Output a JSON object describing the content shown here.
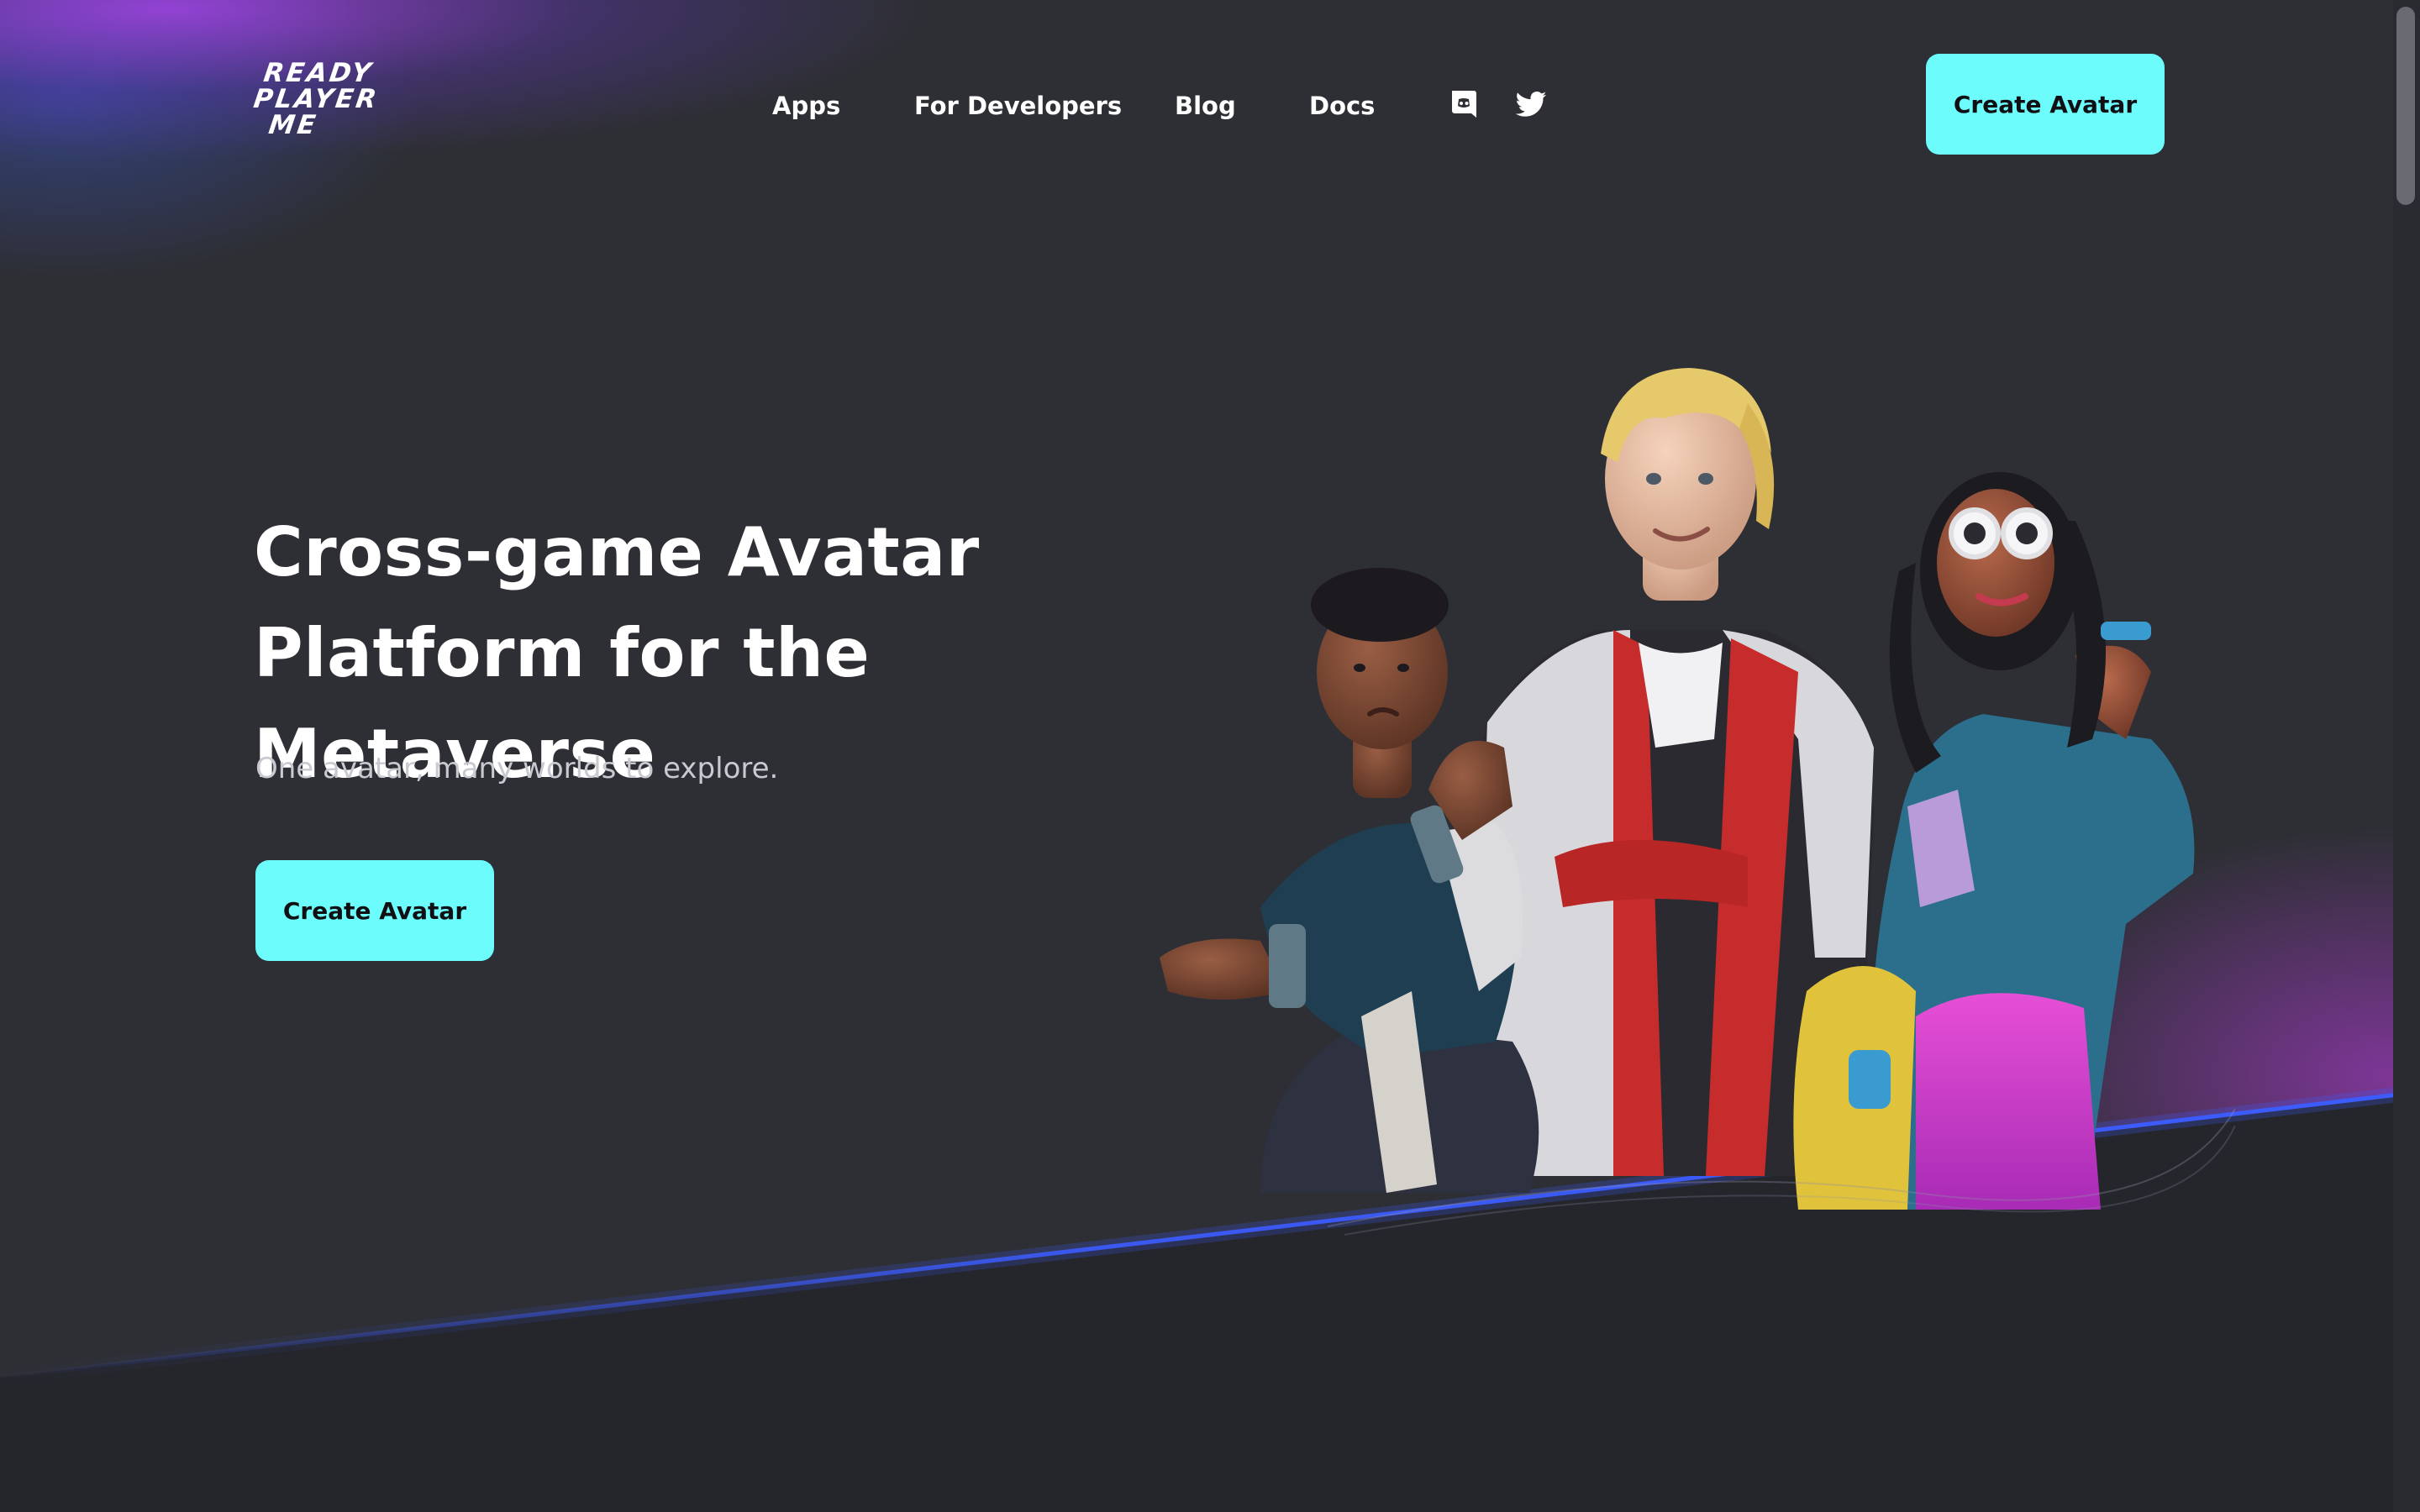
{
  "header": {
    "logo": {
      "line1": "READY",
      "line2": "PLAYER",
      "line3": "ME"
    },
    "nav": [
      {
        "label": "Apps"
      },
      {
        "label": "For Developers"
      },
      {
        "label": "Blog"
      },
      {
        "label": "Docs"
      }
    ],
    "social_icons": [
      "discord-icon",
      "twitter-icon"
    ],
    "cta_label": "Create Avatar"
  },
  "hero": {
    "title_line1": "Cross-game Avatar",
    "title_line2": "Platform for the Metaverse",
    "subtitle": "One avatar, many worlds to explore.",
    "cta_label": "Create Avatar",
    "illustration": "three-3d-avatar-characters"
  },
  "colors": {
    "background": "#2e2f35",
    "accent": "#6cfcfc",
    "lower_section": "#25262c",
    "glow_purple": "#b446ff",
    "glow_blue": "#3c64ff"
  }
}
